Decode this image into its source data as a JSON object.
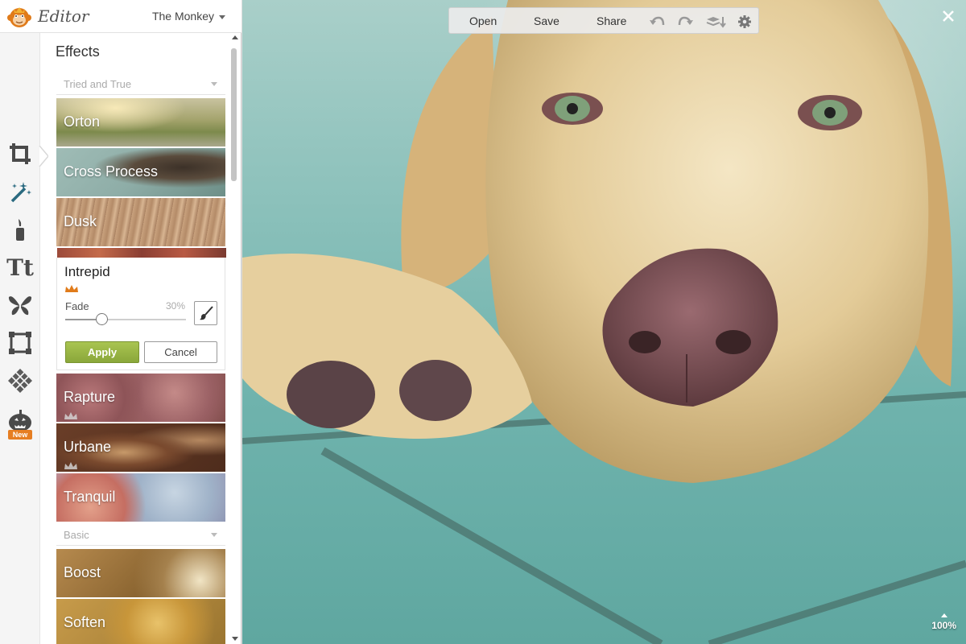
{
  "app": {
    "title": "Editor",
    "user": "The Monkey"
  },
  "tools": [
    {
      "name": "crop-icon"
    },
    {
      "name": "magic-wand-icon",
      "active": true
    },
    {
      "name": "touch-up-brush-icon"
    },
    {
      "name": "text-icon",
      "label": "Tt"
    },
    {
      "name": "butterfly-icon"
    },
    {
      "name": "frame-icon"
    },
    {
      "name": "texture-icon"
    },
    {
      "name": "pumpkin-icon",
      "badge": "New"
    }
  ],
  "effects": {
    "title": "Effects",
    "sections": [
      {
        "label": "Tried and True"
      },
      {
        "label": "Basic"
      }
    ],
    "items": [
      {
        "label": "Orton"
      },
      {
        "label": "Cross Process"
      },
      {
        "label": "Dusk"
      },
      {
        "label": "Rapture",
        "premium": true
      },
      {
        "label": "Urbane",
        "premium": true
      },
      {
        "label": "Tranquil"
      },
      {
        "label": "Boost"
      },
      {
        "label": "Soften"
      }
    ],
    "selected": {
      "label": "Intrepid",
      "premium": true,
      "fade_label": "Fade",
      "fade_value": "30%",
      "fade_fraction": 0.3,
      "apply_label": "Apply",
      "cancel_label": "Cancel"
    }
  },
  "canvas": {
    "actions": {
      "open": "Open",
      "save": "Save",
      "share": "Share"
    },
    "zoom": "100%"
  },
  "colors": {
    "accent": "#8aa73a",
    "crown": "#e07b1a",
    "active_tool": "#2a6a80"
  }
}
